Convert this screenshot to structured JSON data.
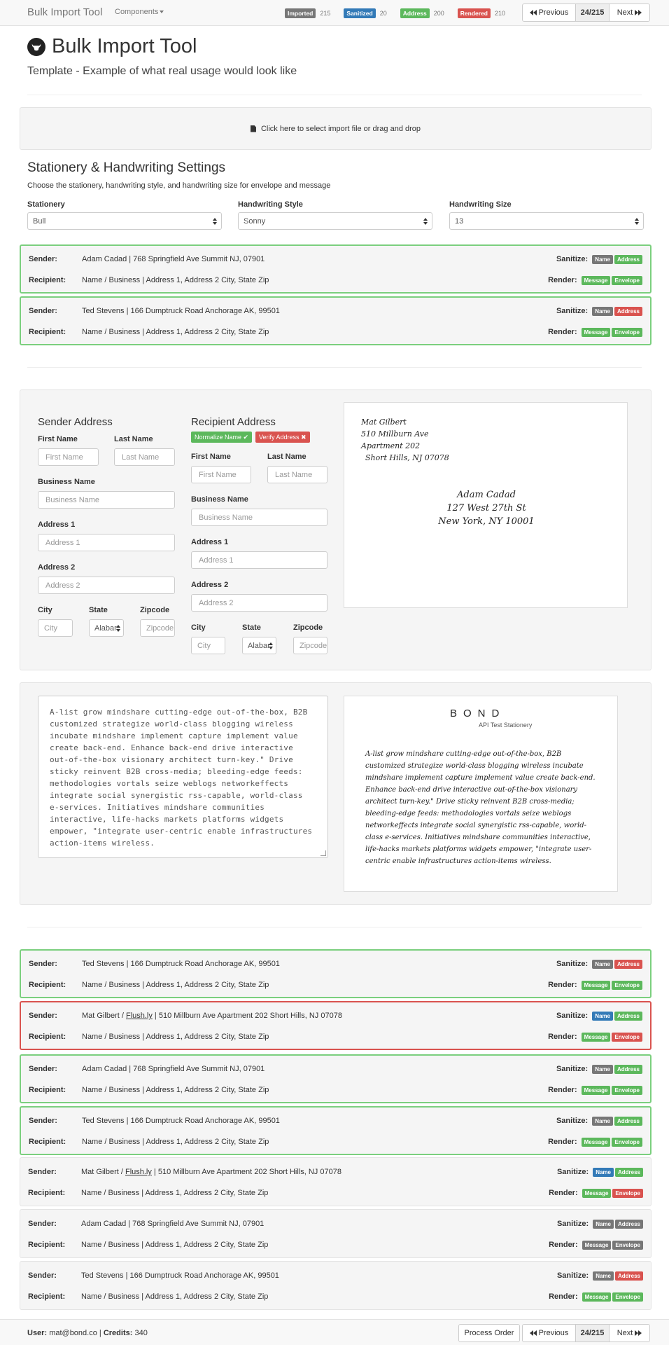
{
  "nav": {
    "brand": "Bulk Import Tool",
    "menu": "Components",
    "stats": [
      {
        "label": "Imported",
        "count": "215",
        "color": "#777777"
      },
      {
        "label": "Sanitized",
        "count": "20",
        "color": "#337ab7"
      },
      {
        "label": "Address",
        "count": "200",
        "color": "#5cb85c"
      },
      {
        "label": "Rendered",
        "count": "210",
        "color": "#d9534f"
      }
    ],
    "previous": "Previous",
    "position": "24/215",
    "next": "Next"
  },
  "header": {
    "title": "Bulk Import Tool",
    "subtitle": "Template - Example of what real usage would look like"
  },
  "dropzone": {
    "text": "Click here to select import file or drag and drop"
  },
  "settings": {
    "title": "Stationery & Handwriting Settings",
    "description": "Choose the stationery, handwriting style, and handwriting size for envelope and message",
    "stationery_label": "Stationery",
    "stationery_value": "Bull",
    "style_label": "Handwriting Style",
    "style_value": "Sonny",
    "size_label": "Handwriting Size",
    "size_value": "13"
  },
  "labels": {
    "sender": "Sender:",
    "recipient": "Recipient:",
    "sanitize": "Sanitize:",
    "render": "Render:",
    "name": "Name",
    "address": "Address",
    "message": "Message",
    "envelope": "Envelope"
  },
  "records_top": [
    {
      "sender": "Adam Cadad | 768 Springfield Ave Summit NJ, 07901",
      "recipient": "Name / Business | Address 1, Address 2 City, State Zip",
      "status": "ok",
      "colors": {
        "name": "#777777",
        "address": "#5cb85c",
        "message": "#5cb85c",
        "envelope": "#5cb85c"
      }
    },
    {
      "sender": "Ted Stevens | 166 Dumptruck Road Anchorage AK, 99501",
      "recipient": "Name / Business | Address 1, Address 2 City, State Zip",
      "status": "ok",
      "colors": {
        "name": "#777777",
        "address": "#d9534f",
        "message": "#5cb85c",
        "envelope": "#5cb85c"
      }
    }
  ],
  "editor": {
    "sender_title": "Sender Address",
    "recipient_title": "Recipient Address",
    "normalize_label": "Normalize Name ✔",
    "verify_label": "Verify Address ✖",
    "first_name_label": "First Name",
    "last_name_label": "Last Name",
    "business_label": "Business Name",
    "address1_label": "Address 1",
    "address2_label": "Address 2",
    "city_label": "City",
    "state_label": "State",
    "zip_label": "Zipcode",
    "first_name_ph": "First Name",
    "last_name_ph": "Last Name",
    "business_ph": "Business Name",
    "address1_ph": "Address 1",
    "address2_ph": "Address 2",
    "city_ph": "City",
    "state_value": "Alabar",
    "zip_ph": "Zipcode"
  },
  "envelope_preview": {
    "return_lines": [
      "Mat Gilbert",
      "510 Millburn Ave",
      "Apartment 202",
      "Short Hills, NJ 07078"
    ],
    "recipient_lines": [
      "Adam Cadad",
      "127 West 27th St",
      "New York, NY 10001"
    ]
  },
  "message": {
    "text": "A-list grow mindshare cutting-edge out-of-the-box, B2B customized strategize world-class blogging wireless incubate mindshare implement capture implement value create back-end. Enhance back-end drive interactive out-of-the-box visionary architect turn-key.\" Drive sticky reinvent B2B cross-media; bleeding-edge feeds: methodologies vortals seize weblogs networkeffects integrate social synergistic rss-capable, world-class e-services. Initiatives mindshare communities interactive, life-hacks markets platforms widgets empower, \"integrate user-centric enable infrastructures action-items wireless.",
    "stationery_logo": "BOND",
    "stationery_caption": "API Test Stationery"
  },
  "records_bottom": [
    {
      "sender": "Ted Stevens | 166 Dumptruck Road Anchorage AK, 99501",
      "recipient": "Name / Business | Address 1, Address 2 City, State Zip",
      "status": "ok",
      "colors": {
        "name": "#777777",
        "address": "#d9534f",
        "message": "#5cb85c",
        "envelope": "#5cb85c"
      }
    },
    {
      "sender_name": "Mat Gilbert / ",
      "sender_link": "Flush.ly",
      "sender_rest": " | 510 Millburn Ave Apartment 202 Short Hills, NJ 07078",
      "recipient": "Name / Business | Address 1, Address 2 City, State Zip",
      "status": "error",
      "colors": {
        "name": "#337ab7",
        "address": "#5cb85c",
        "message": "#5cb85c",
        "envelope": "#d9534f"
      }
    },
    {
      "sender": "Adam Cadad | 768 Springfield Ave Summit NJ, 07901",
      "recipient": "Name / Business | Address 1, Address 2 City, State Zip",
      "status": "ok",
      "colors": {
        "name": "#777777",
        "address": "#5cb85c",
        "message": "#5cb85c",
        "envelope": "#5cb85c"
      }
    },
    {
      "sender": "Ted Stevens | 166 Dumptruck Road Anchorage AK, 99501",
      "recipient": "Name / Business | Address 1, Address 2 City, State Zip",
      "status": "ok",
      "colors": {
        "name": "#777777",
        "address": "#5cb85c",
        "message": "#5cb85c",
        "envelope": "#5cb85c"
      }
    },
    {
      "sender_name": "Mat Gilbert / ",
      "sender_link": "Flush.ly",
      "sender_rest": " | 510 Millburn Ave Apartment 202 Short Hills, NJ 07078",
      "recipient": "Name / Business | Address 1, Address 2 City, State Zip",
      "status": "pending",
      "colors": {
        "name": "#337ab7",
        "address": "#5cb85c",
        "message": "#5cb85c",
        "envelope": "#d9534f"
      }
    },
    {
      "sender": "Adam Cadad | 768 Springfield Ave Summit NJ, 07901",
      "recipient": "Name / Business | Address 1, Address 2 City, State Zip",
      "status": "pending",
      "colors": {
        "name": "#777777",
        "address": "#777777",
        "message": "#777777",
        "envelope": "#777777"
      }
    },
    {
      "sender": "Ted Stevens | 166 Dumptruck Road Anchorage AK, 99501",
      "recipient": "Name / Business | Address 1, Address 2 City, State Zip",
      "status": "pending",
      "colors": {
        "name": "#777777",
        "address": "#d9534f",
        "message": "#5cb85c",
        "envelope": "#5cb85c"
      }
    }
  ],
  "footer": {
    "user_label": "User:",
    "user_email": "mat@bond.co",
    "credits_label": "Credits:",
    "credits_value": "340",
    "process_order": "Process Order",
    "previous": "Previous",
    "position": "24/215",
    "next": "Next"
  }
}
